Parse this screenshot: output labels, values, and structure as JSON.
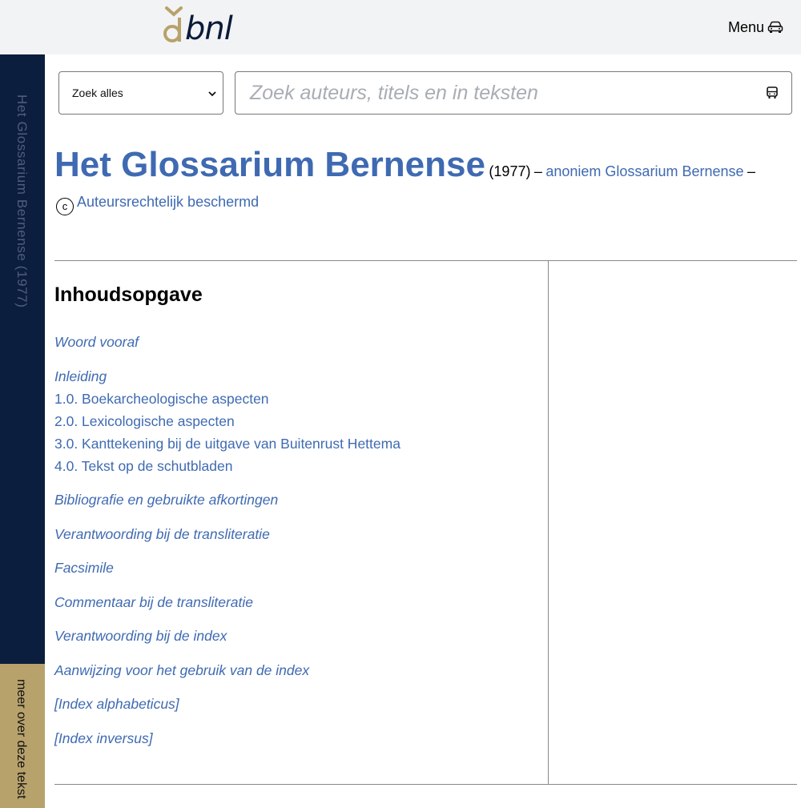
{
  "header": {
    "logo_text": "bnl",
    "menu_label": "Menu",
    "menu_icon": "car-icon"
  },
  "sidebar": {
    "title": "Het Glossarium Bernense (1977)",
    "more_label": "meer over deze tekst"
  },
  "search": {
    "scope_value": "Zoek alles",
    "placeholder": "Zoek auteurs, titels en in teksten",
    "button_icon": "bus-icon"
  },
  "work": {
    "title": "Het Glossarium Bernense",
    "year": "(1977)",
    "author_link": "anoniem Glossarium Bernense",
    "copyright_symbol": "c",
    "copyright_label": "Auteursrechtelijk beschermd"
  },
  "toc": {
    "heading": "Inhoudsopgave",
    "items": [
      {
        "label": "Woord vooraf"
      },
      {
        "label": "Inleiding"
      },
      {
        "label": "1.0. Boekarcheologische aspecten"
      },
      {
        "label": "2.0. Lexicologische aspecten"
      },
      {
        "label": "3.0. Kanttekening bij de uitgave van Buitenrust Hettema"
      },
      {
        "label": "4.0. Tekst op de schutbladen"
      },
      {
        "label": "Bibliografie en gebruikte afkortingen"
      },
      {
        "label": "Verantwoording bij de transliteratie"
      },
      {
        "label": "Facsimile"
      },
      {
        "label": "Commentaar bij de transliteratie"
      },
      {
        "label": "Verantwoording bij de index"
      },
      {
        "label": "Aanwijzing voor het gebruik van de index"
      },
      {
        "label": "[Index alphabeticus]"
      },
      {
        "label": "[Index inversus]"
      }
    ]
  },
  "colors": {
    "link": "#3f6ab2",
    "sidebar_dark": "#0b1e3e",
    "sidebar_gold": "#b8a26c",
    "topbar": "#f2f3f4"
  }
}
